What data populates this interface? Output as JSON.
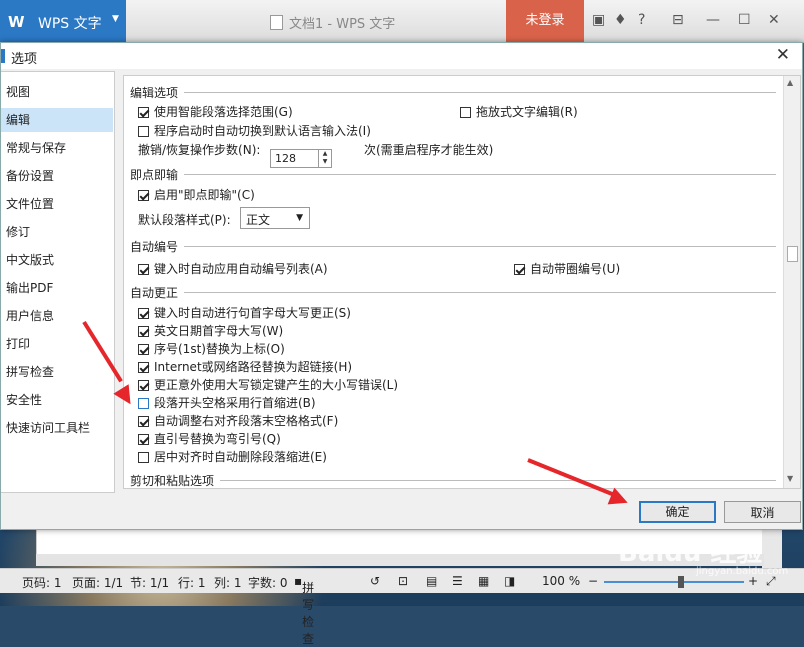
{
  "app": {
    "logo": "W",
    "name": "WPS 文字",
    "doc_title": "文档1 - WPS 文字",
    "login": "未登录",
    "help": "?"
  },
  "dialog": {
    "title": "选项",
    "close": "✕",
    "nav": [
      {
        "label": "视图"
      },
      {
        "label": "编辑",
        "selected": true
      },
      {
        "label": "常规与保存"
      },
      {
        "label": "备份设置"
      },
      {
        "label": "文件位置"
      },
      {
        "label": "修订"
      },
      {
        "label": "中文版式"
      },
      {
        "label": "输出PDF"
      },
      {
        "label": "用户信息"
      },
      {
        "label": "打印"
      },
      {
        "label": "拼写检查"
      },
      {
        "label": "安全性"
      },
      {
        "label": "快速访问工具栏"
      }
    ],
    "sections": {
      "edit": {
        "title": "编辑选项",
        "smart_select": {
          "label": "使用智能段落选择范围(G)",
          "checked": true
        },
        "drag_drop": {
          "label": "拖放式文字编辑(R)",
          "checked": false
        },
        "ime_switch": {
          "label": "程序启动时自动切换到默认语言输入法(I)",
          "checked": false
        },
        "undo_label": "撤销/恢复操作步数(N):",
        "undo_value": "128",
        "undo_note": "次(需重启程序才能生效)"
      },
      "click_type": {
        "title": "即点即输",
        "enable": {
          "label": "启用\"即点即输\"(C)",
          "checked": true
        },
        "para_style_label": "默认段落样式(P):",
        "para_style_value": "正文"
      },
      "auto_number": {
        "title": "自动编号",
        "list": {
          "label": "键入时自动应用自动编号列表(A)",
          "checked": true
        },
        "circle": {
          "label": "自动带圈编号(U)",
          "checked": true
        }
      },
      "autocorrect": {
        "title": "自动更正",
        "items": [
          {
            "label": "键入时自动进行句首字母大写更正(S)",
            "checked": true
          },
          {
            "label": "英文日期首字母大写(W)",
            "checked": true
          },
          {
            "label": "序号(1st)替换为上标(O)",
            "checked": true
          },
          {
            "label": "Internet或网络路径替换为超链接(H)",
            "checked": true
          },
          {
            "label": "更正意外使用大写锁定键产生的大小写错误(L)",
            "checked": true
          },
          {
            "label": "段落开头空格采用行首缩进(B)",
            "checked": false
          },
          {
            "label": "自动调整右对齐段落末空格格式(F)",
            "checked": true
          },
          {
            "label": "直引号替换为弯引号(Q)",
            "checked": true
          },
          {
            "label": "居中对齐时自动删除段落缩进(E)",
            "checked": false
          }
        ]
      },
      "paste": {
        "title": "剪切和粘贴选项"
      }
    },
    "ok": "确定",
    "cancel": "取消"
  },
  "statusbar": {
    "page_no": "页码: 1",
    "pages": "页面: 1/1",
    "section": "节: 1/1",
    "row": "行: 1",
    "col": "列: 1",
    "words": "字数: 0",
    "spell": "拼写检查",
    "zoom": "100 %",
    "minus": "−",
    "plus": "+"
  },
  "watermark": {
    "text": "Baidu 经验",
    "sub": "jingyan.baidu.com"
  },
  "colors": {
    "accent": "#2b78c5",
    "login": "#d9634a",
    "annotation": "#e5262b",
    "nav_selected": "#cce4f7"
  }
}
